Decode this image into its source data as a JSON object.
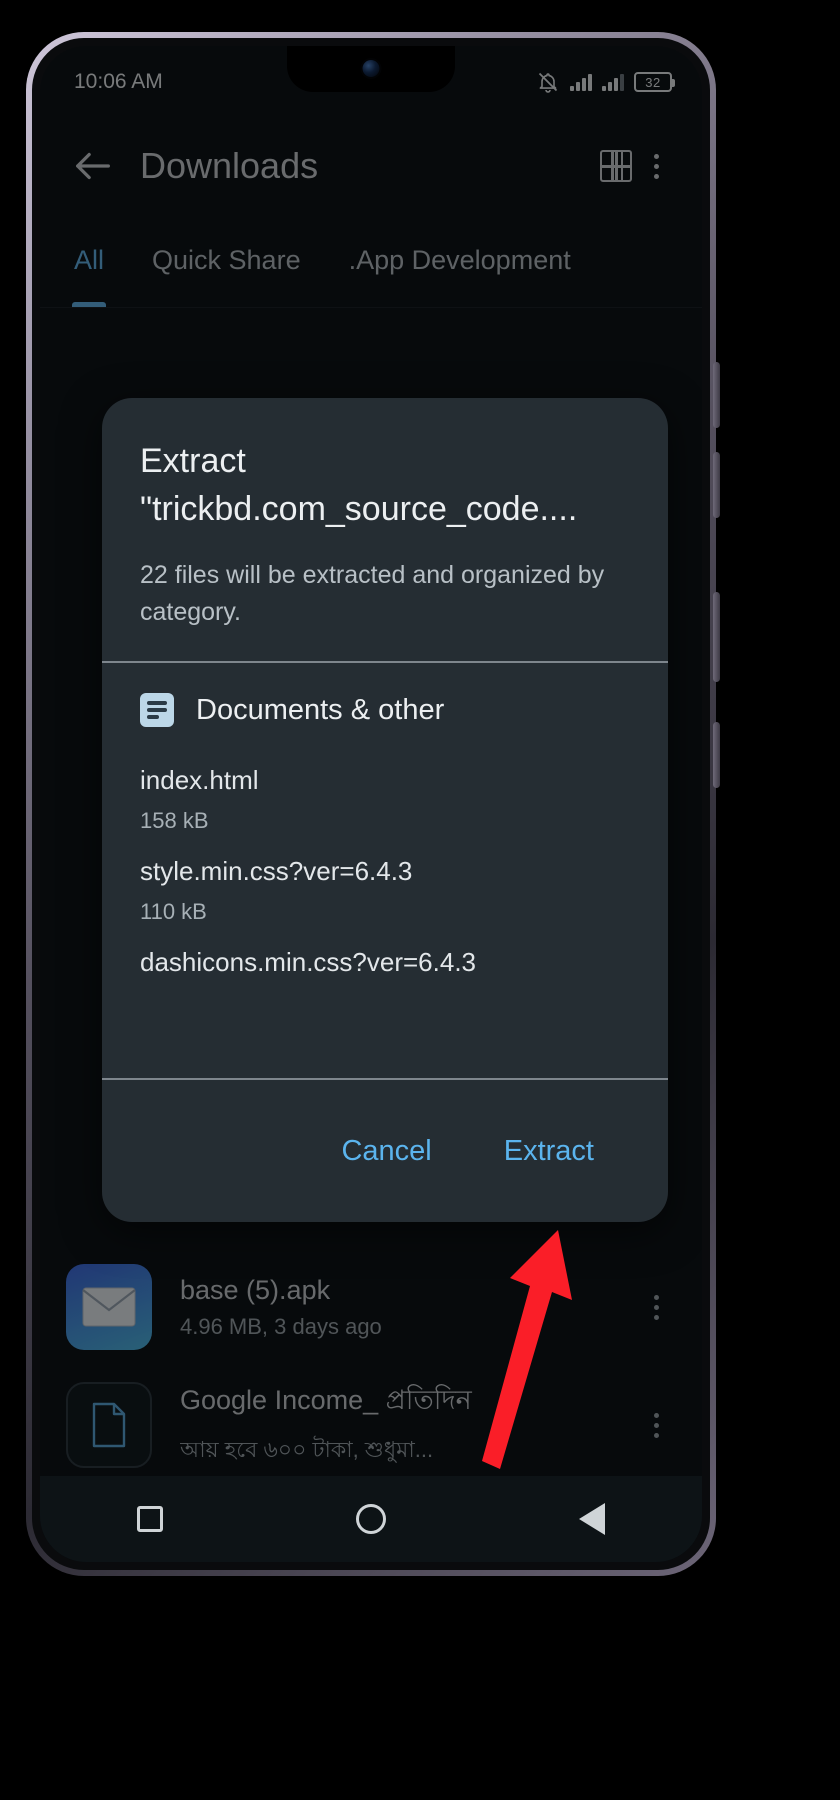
{
  "status_bar": {
    "time": "10:06 AM",
    "icons": [
      "bell-off-icon",
      "signal-icon",
      "signal-icon"
    ],
    "battery_level": "32"
  },
  "app_bar": {
    "back_label": "back-arrow-icon",
    "title": "Downloads",
    "grid_view_label": "grid-view-icon",
    "overflow_label": "more-options-icon"
  },
  "tabs": {
    "active_color": "#63b3e8",
    "items": [
      {
        "label": "All",
        "active": true
      },
      {
        "label": "Quick Share",
        "active": false
      },
      {
        "label": ".App Development",
        "active": false
      }
    ]
  },
  "dialog": {
    "title": "Extract",
    "filename": "\"trickbd.com_source_code....",
    "body": "22 files will be extracted and organized by category.",
    "category": {
      "icon": "document-icon",
      "icon_color": "#bcd7e8",
      "title": "Documents & other"
    },
    "files": [
      {
        "name": "index.html",
        "size": "158 kB"
      },
      {
        "name": "style.min.css?ver=6.4.3",
        "size": "110 kB"
      },
      {
        "name": "dashicons.min.css?ver=6.4.3",
        "size": ""
      }
    ],
    "actions": {
      "cancel_label": "Cancel",
      "confirm_label": "Extract",
      "action_color": "#5bb4ee"
    }
  },
  "background_list": {
    "items": [
      {
        "name": "base (5).apk",
        "sub": "4.96 MB, 3 days ago",
        "thumb": "mail-icon"
      },
      {
        "name": "Google Income_ প্রতিদিন",
        "sub": "আয় হবে ৬০০ টাকা, শুধুমা...",
        "thumb": "document-file-icon"
      }
    ]
  },
  "nav_bar": {
    "recents": "square-recents-icon",
    "home": "circle-home-icon",
    "back": "triangle-back-icon"
  },
  "annotation": {
    "arrow_color": "#fa1e28",
    "points_at": "Extract"
  }
}
